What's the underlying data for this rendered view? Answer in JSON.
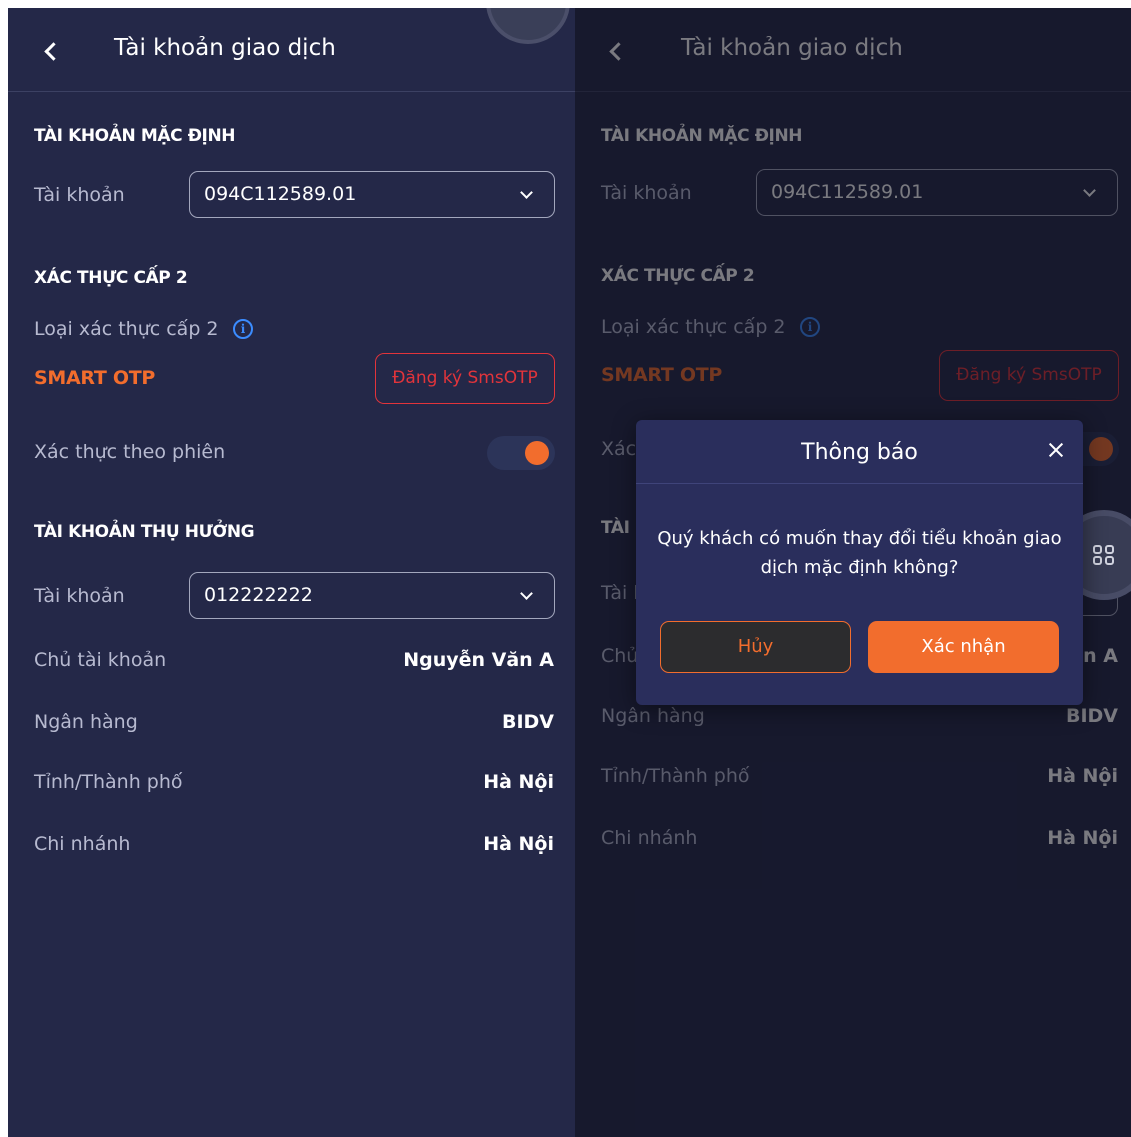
{
  "header": {
    "title": "Tài khoản giao dịch"
  },
  "default_account": {
    "section_title": "TÀI KHOẢN MẶC ĐỊNH",
    "account_label": "Tài khoản",
    "account_value": "094C112589.01"
  },
  "auth": {
    "section_title": "XÁC THỰC CẤP 2",
    "type_label": "Loại xác thực cấp 2",
    "info_icon": "info-icon",
    "type_value": "SMART OTP",
    "register_button": "Đăng ký SmsOTP",
    "session_label": "Xác thực theo phiên",
    "session_enabled": true
  },
  "beneficiary": {
    "section_title": "TÀI KHOẢN THỤ HƯỞNG",
    "account_label": "Tài khoản",
    "account_value": "012222222",
    "rows": [
      {
        "label": "Chủ tài khoản",
        "value": "Nguyễn Văn A"
      },
      {
        "label": "Ngân hàng",
        "value": "BIDV"
      },
      {
        "label": "Tỉnh/Thành phố",
        "value": "Hà Nội"
      },
      {
        "label": "Chi nhánh",
        "value": "Hà Nội"
      }
    ]
  },
  "dialog": {
    "title": "Thông báo",
    "message": "Quý khách có muốn thay đổi tiểu khoản giao dịch mặc định không?",
    "cancel_label": "Hủy",
    "confirm_label": "Xác nhận"
  },
  "colors": {
    "background": "#242848",
    "accent": "#f26d2d",
    "danger": "#e2343b",
    "info": "#3b8cff",
    "dialog_bg": "#2a2e5c"
  }
}
